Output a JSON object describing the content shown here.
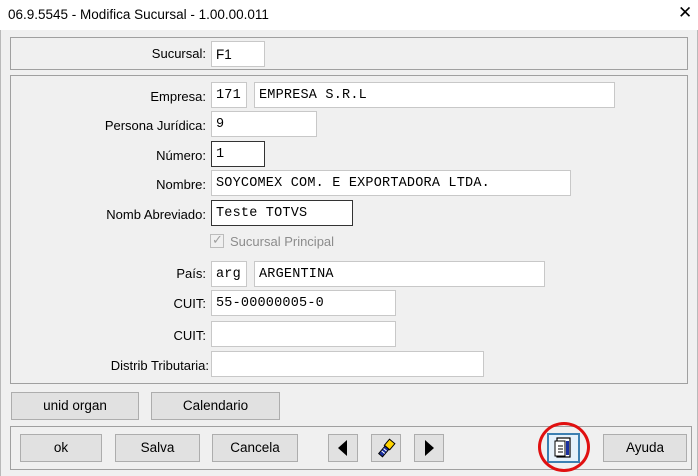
{
  "window": {
    "title": "06.9.5545 - Modifica Sucursal - 1.00.00.011",
    "close_glyph": "✕"
  },
  "header": {
    "sucursal_label": "Sucursal:",
    "sucursal_value": "F1"
  },
  "form": {
    "empresa_label": "Empresa:",
    "empresa_code": "171",
    "empresa_name": "EMPRESA  S.R.L",
    "persona_label": "Persona Jurídica:",
    "persona_value": "9",
    "numero_label": "Número:",
    "numero_value": "1",
    "nombre_label": "Nombre:",
    "nombre_value": "SOYCOMEX COM. E EXPORTADORA LTDA.",
    "abreviado_label": "Nomb Abreviado:",
    "abreviado_value": "Teste TOTVS",
    "principal_label": "Sucursal Principal",
    "principal_checked": true,
    "pais_label": "País:",
    "pais_code": "arg",
    "pais_name": "ARGENTINA",
    "cuit_label": "CUIT:",
    "cuit_value": "55-00000005-0",
    "cuit2_label": "CUIT:",
    "cuit2_value": "",
    "distrib_label": "Distrib Tributaria:",
    "distrib_value": ""
  },
  "extra_buttons": {
    "unid_organ": "unid organ",
    "calendario": "Calendario"
  },
  "toolbar": {
    "ok": "ok",
    "salva": "Salva",
    "cancela": "Cancela",
    "ayuda": "Ayuda",
    "icons": [
      "prev-record-icon",
      "search-flashlight-icon",
      "next-record-icon",
      "document-report-icon"
    ],
    "highlight_color": "#e01010"
  }
}
